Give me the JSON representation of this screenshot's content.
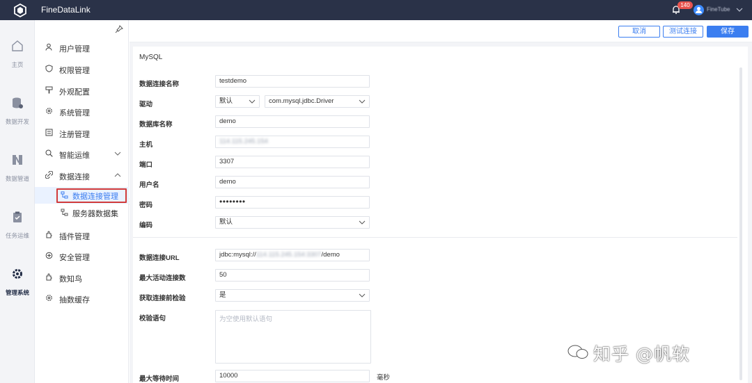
{
  "app": {
    "title": "FineDataLink",
    "notifications": "140",
    "user": "FineTube"
  },
  "rail": [
    {
      "label": "主页",
      "icon": "home-icon"
    },
    {
      "label": "数据开发",
      "icon": "database-icon"
    },
    {
      "label": "数据管道",
      "icon": "pipeline-icon"
    },
    {
      "label": "任务运维",
      "icon": "clipboard-icon"
    },
    {
      "label": "管理系统",
      "icon": "gear-icon",
      "active": true
    }
  ],
  "menu": {
    "items": [
      "用户管理",
      "权限管理",
      "外观配置",
      "系统管理",
      "注册管理",
      "智能运维",
      "数据连接",
      "插件管理",
      "安全管理",
      "数知鸟",
      "抽数缓存"
    ],
    "sub_items": [
      "数据连接管理",
      "服务器数据集"
    ]
  },
  "actions": {
    "cancel": "取消",
    "test": "测试连接",
    "save": "保存"
  },
  "form": {
    "section": "MySQL",
    "labels": {
      "name": "数据连接名称",
      "driver": "驱动",
      "db": "数据库名称",
      "host": "主机",
      "port": "端口",
      "user": "用户名",
      "password": "密码",
      "encoding": "编码",
      "url": "数据连接URL",
      "max_active": "最大活动连接数",
      "test_before": "获取连接前检验",
      "validation": "校验语句",
      "max_wait": "最大等待时间"
    },
    "values": {
      "name": "testdemo",
      "driver_mode": "默认",
      "driver_class": "com.mysql.jdbc.Driver",
      "db": "demo",
      "host": "114.115.245.154",
      "port": "3307",
      "user": "demo",
      "password": "••••••••",
      "encoding": "默认",
      "url_prefix": "jdbc:mysql://",
      "url_host": "114.115.245.154:3307",
      "url_suffix": "/demo",
      "max_active": "50",
      "test_before": "是",
      "max_wait": "10000"
    },
    "validation_placeholder": "为空使用默认语句",
    "unit_ms": "毫秒"
  },
  "watermark": "知乎 @帆软"
}
